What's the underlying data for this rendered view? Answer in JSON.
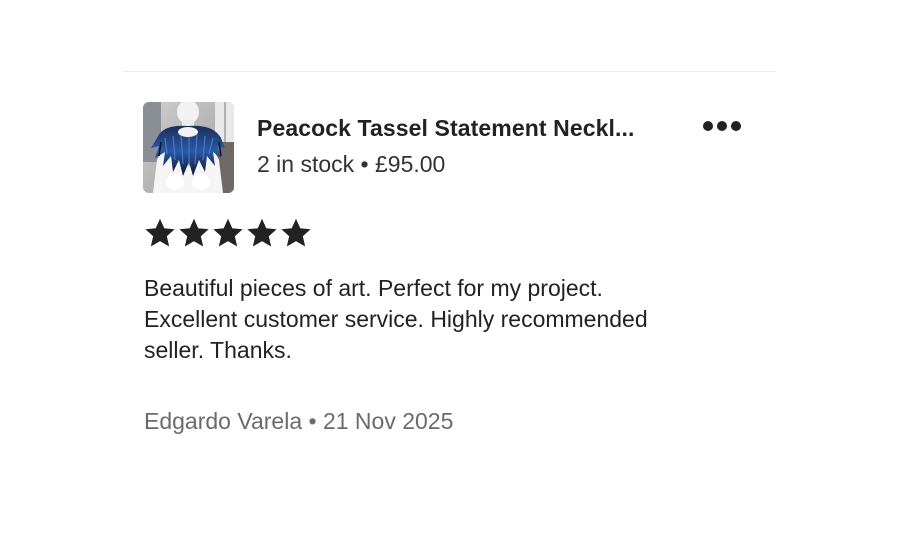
{
  "listing": {
    "title": "Peacock Tassel Statement Neckl...",
    "stock_and_price": "2 in stock • £95.00",
    "more_icon": "ellipsis-icon"
  },
  "review": {
    "rating": 5,
    "rating_max": 5,
    "star_color": "#222222",
    "text": "Beautiful pieces of art.  Perfect for my project.\nExcellent customer service.  Highly recommended\nseller. Thanks.",
    "byline": "Edgardo Varela • 21 Nov 2025"
  }
}
